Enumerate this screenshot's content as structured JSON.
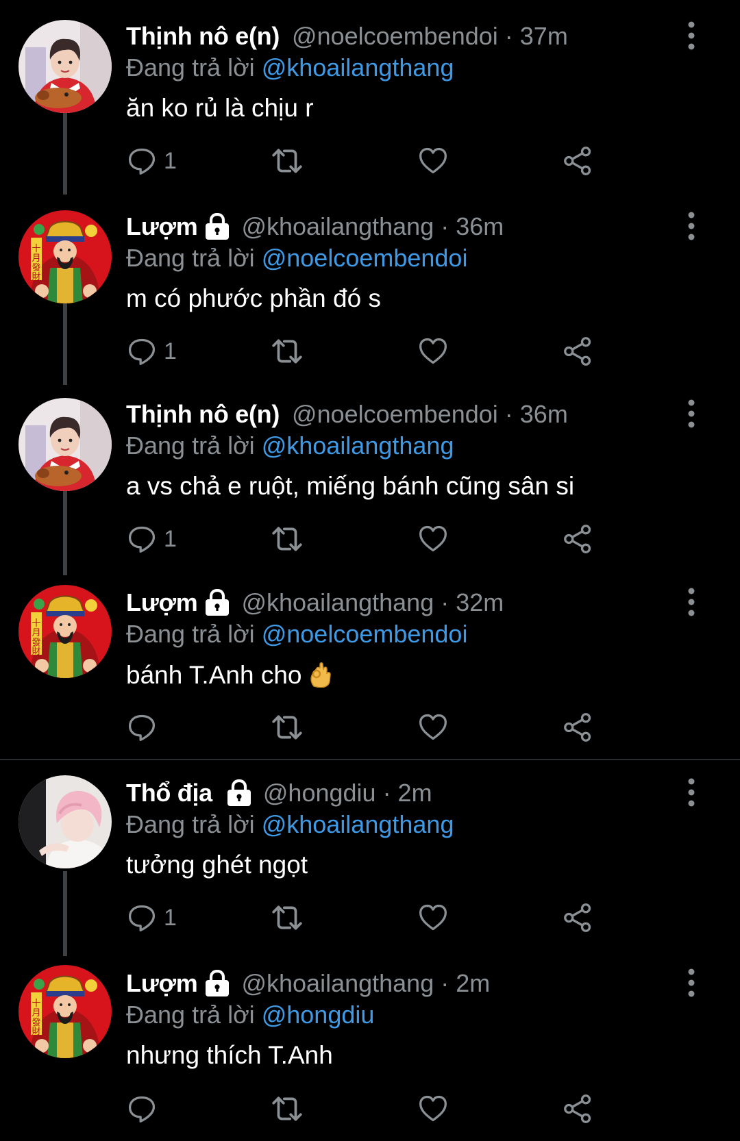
{
  "tweets": [
    {
      "display_name": "Thịnh nô e(n)",
      "handle": "@noelcoembendoi",
      "time": "· 37m",
      "protected": false,
      "reply_prefix": "Đang trả lời",
      "reply_to": "@khoailangthang",
      "text": "ăn ko rủ là chịu r",
      "reply_count": "1",
      "avatar": "santa-boy-avatar"
    },
    {
      "display_name": "Lượm",
      "handle": "@khoailangthang",
      "time": "· 36m",
      "protected": true,
      "reply_prefix": "Đang trả lời",
      "reply_to": "@noelcoembendoi",
      "text": "m có phước phần đó s",
      "reply_count": "1",
      "avatar": "god-of-wealth-avatar"
    },
    {
      "display_name": "Thịnh nô e(n)",
      "handle": "@noelcoembendoi",
      "time": "· 36m",
      "protected": false,
      "reply_prefix": "Đang trả lời",
      "reply_to": "@khoailangthang",
      "text": "a vs chả e ruột, miếng bánh cũng sân si",
      "reply_count": "1",
      "avatar": "santa-boy-avatar"
    },
    {
      "display_name": "Lượm",
      "handle": "@khoailangthang",
      "time": "· 32m",
      "protected": true,
      "reply_prefix": "Đang trả lời",
      "reply_to": "@noelcoembendoi",
      "text": "bánh T.Anh cho",
      "emoji": "ok-hand-emoji",
      "reply_count": "",
      "avatar": "god-of-wealth-avatar"
    },
    {
      "display_name": "Thổ địa",
      "handle": "@hongdiu",
      "time": "· 2m",
      "protected": true,
      "reply_prefix": "Đang trả lời",
      "reply_to": "@khoailangthang",
      "text": "tưởng ghét ngọt",
      "reply_count": "1",
      "avatar": "pink-hair-avatar"
    },
    {
      "display_name": "Lượm",
      "handle": "@khoailangthang",
      "time": "· 2m",
      "protected": true,
      "reply_prefix": "Đang trả lời",
      "reply_to": "@hongdiu",
      "text": "nhưng thích T.Anh",
      "reply_count": "",
      "avatar": "god-of-wealth-avatar"
    }
  ],
  "colors": {
    "background": "#000000",
    "name": "#ffffff",
    "secondary": "#8b9095",
    "mention": "#3f9ae6",
    "thread_line": "#3e4144"
  }
}
